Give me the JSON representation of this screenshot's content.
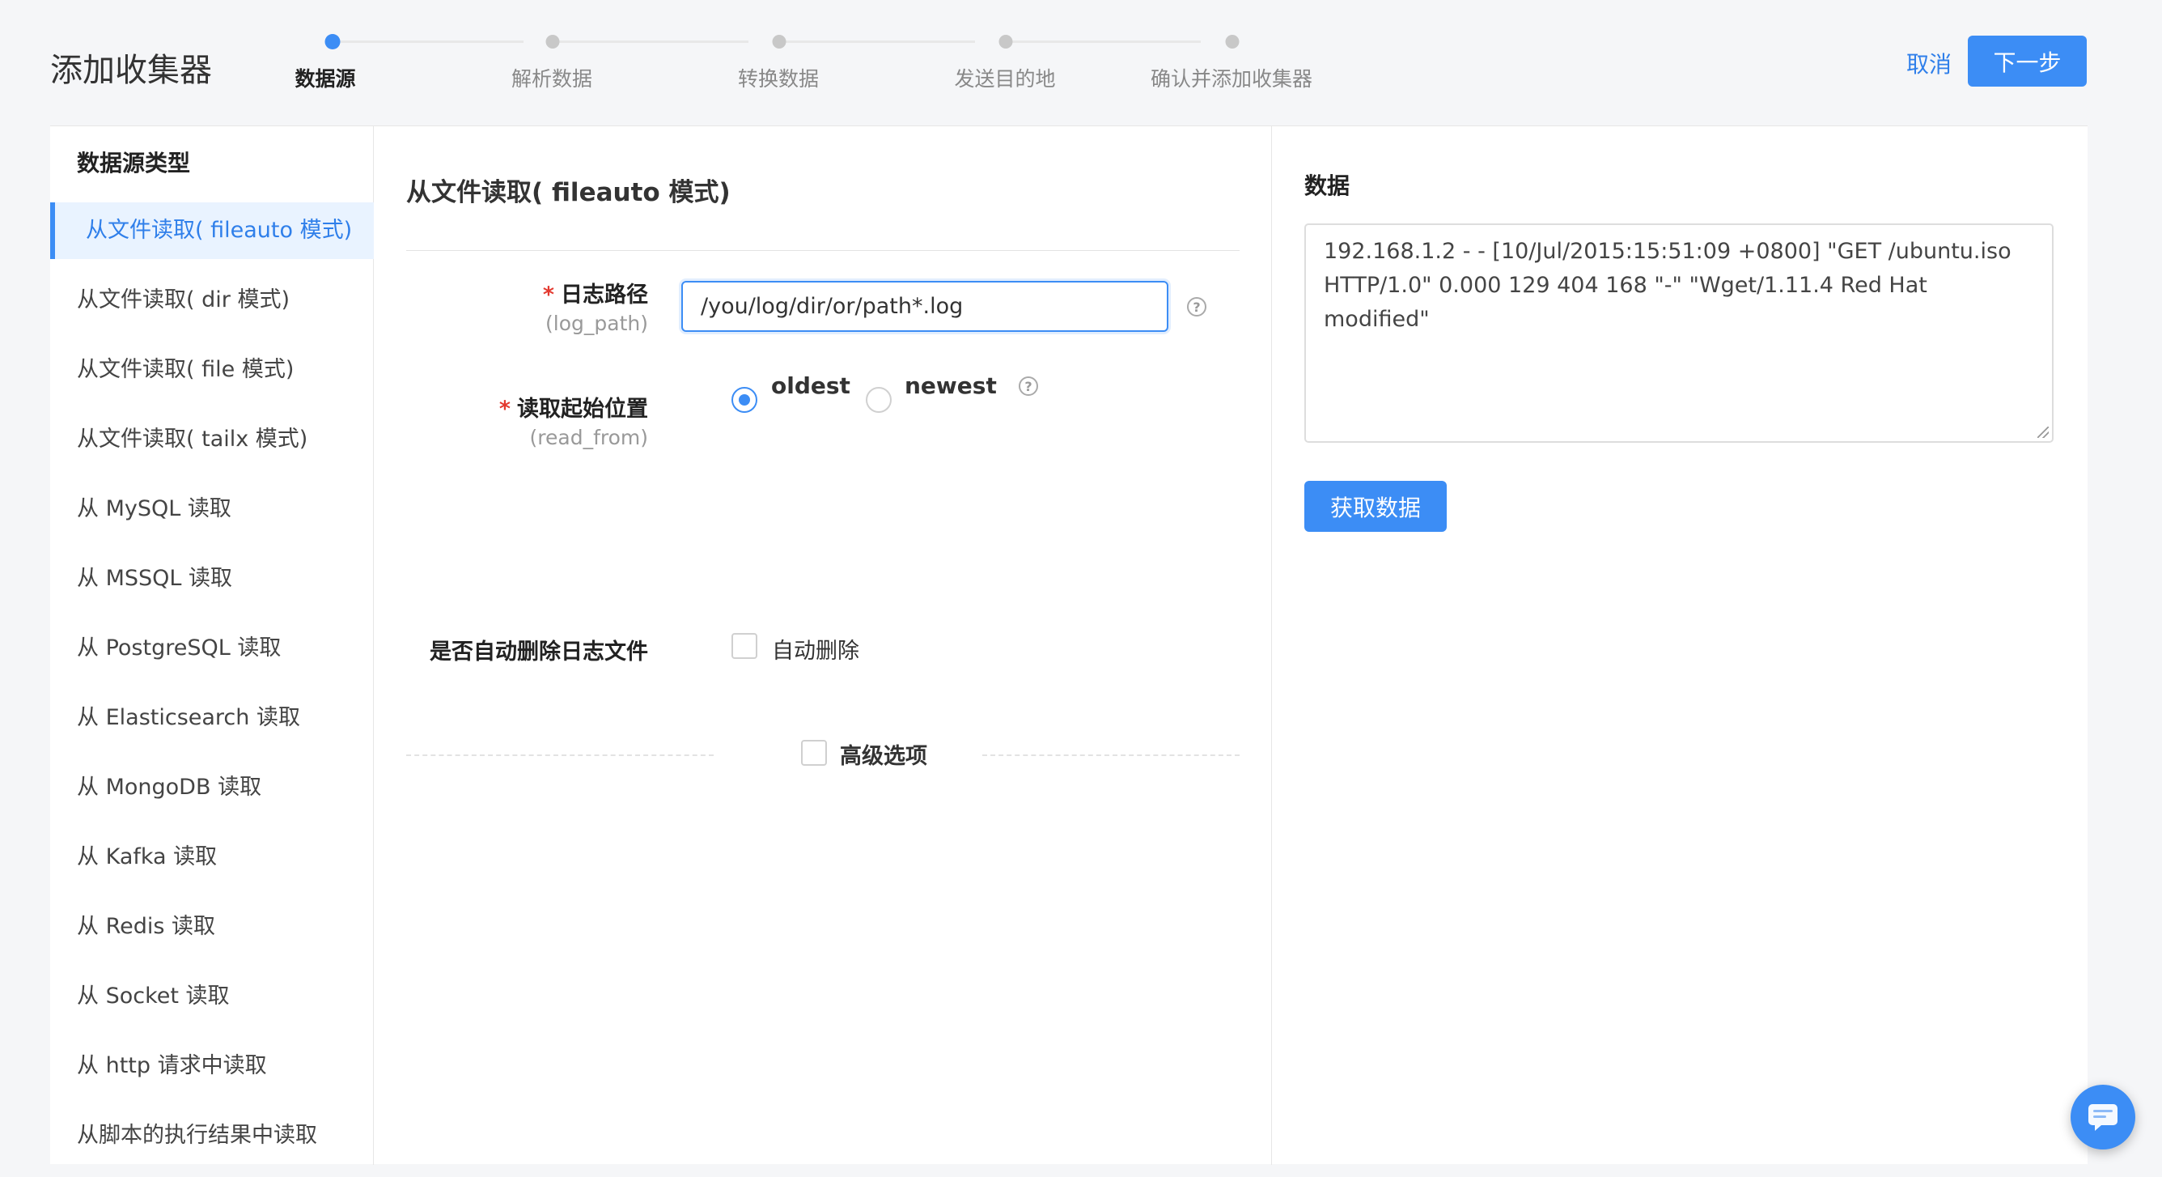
{
  "header": {
    "title": "添加收集器",
    "cancel_label": "取消",
    "next_label": "下一步"
  },
  "steps": [
    {
      "label": "数据源",
      "active": true
    },
    {
      "label": "解析数据",
      "active": false
    },
    {
      "label": "转换数据",
      "active": false
    },
    {
      "label": "发送目的地",
      "active": false
    },
    {
      "label": "确认并添加收集器",
      "active": false
    }
  ],
  "sidebar": {
    "title": "数据源类型",
    "items": [
      {
        "label": "从文件读取( fileauto 模式)",
        "active": true
      },
      {
        "label": "从文件读取( dir 模式)"
      },
      {
        "label": "从文件读取( file 模式)"
      },
      {
        "label": "从文件读取( tailx 模式)"
      },
      {
        "label": "从 MySQL 读取"
      },
      {
        "label": "从 MSSQL 读取"
      },
      {
        "label": "从 PostgreSQL 读取"
      },
      {
        "label": "从 Elasticsearch 读取"
      },
      {
        "label": "从 MongoDB 读取"
      },
      {
        "label": "从 Kafka 读取"
      },
      {
        "label": "从 Redis 读取"
      },
      {
        "label": "从 Socket 读取"
      },
      {
        "label": "从 http 请求中读取"
      },
      {
        "label": "从脚本的执行结果中读取"
      }
    ]
  },
  "form": {
    "title": "从文件读取( fileauto 模式)",
    "required_mark": "*",
    "log_path": {
      "label": "日志路径",
      "sub": "(log_path)",
      "value": "/you/log/dir/or/path*.log"
    },
    "read_from": {
      "label": "读取起始位置",
      "sub": "(read_from)",
      "option_oldest": "oldest",
      "option_newest": "newest",
      "selected": "oldest"
    },
    "auto_delete": {
      "label": "是否自动删除日志文件",
      "checkbox_label": "自动删除"
    },
    "advanced": {
      "label": "高级选项"
    },
    "help_glyph": "?"
  },
  "data_panel": {
    "title": "数据",
    "sample": "192.168.1.2 - - [10/Jul/2015:15:51:09 +0800] \"GET /ubuntu.iso HTTP/1.0\" 0.000 129 404 168 \"-\" \"Wget/1.11.4 Red Hat modified\"",
    "fetch_label": "获取数据"
  },
  "colors": {
    "accent": "#3c8df5",
    "required": "#e3392f",
    "active_bg": "#e9f3ff"
  }
}
